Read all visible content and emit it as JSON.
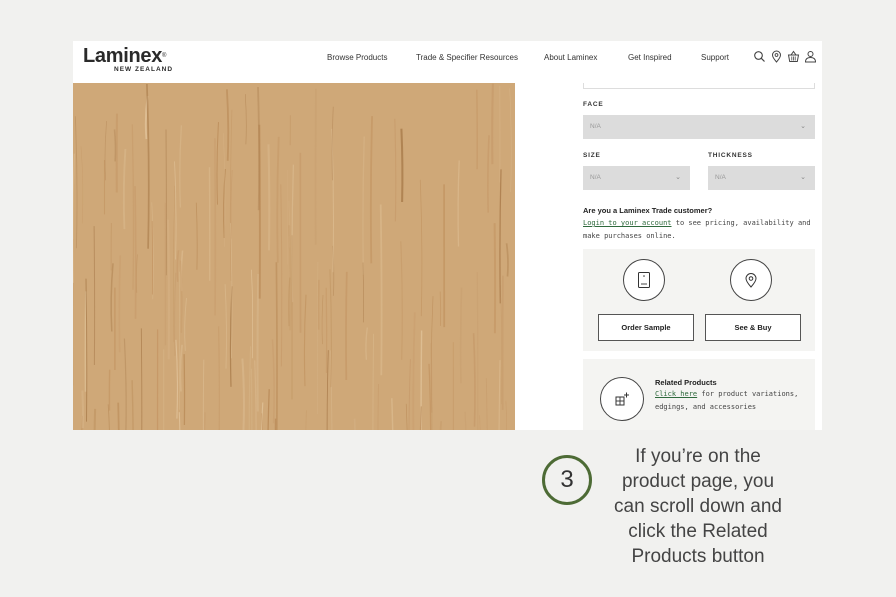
{
  "header": {
    "logo_main": "Laminex",
    "logo_reg": "®",
    "logo_sub": "NEW ZEALAND",
    "nav": [
      "Browse Products",
      "Trade & Specifier Resources",
      "About Laminex",
      "Get Inspired",
      "Support"
    ],
    "icons": [
      "search-icon",
      "location-pin-icon",
      "basket-icon",
      "user-icon"
    ]
  },
  "product_image": {
    "description_icon": "wood-grain-swatch",
    "color": "#cfa878"
  },
  "options": {
    "face_label": "FACE",
    "face_value": "N/A",
    "size_label": "SIZE",
    "size_value": "N/A",
    "thickness_label": "THICKNESS",
    "thickness_value": "N/A"
  },
  "trade": {
    "question": "Are you a Laminex Trade customer?",
    "link": "Login to your account",
    "text": " to see pricing, availability and make purchases online."
  },
  "actions": {
    "order_sample": "Order Sample",
    "see_buy": "See & Buy"
  },
  "related": {
    "title": "Related Products",
    "link": "Click here",
    "text": " for product variations, edgings, and accessories"
  },
  "annotation": {
    "step": "3",
    "lines": [
      "If you’re on the",
      "product page, you",
      "can scroll down and",
      "click the Related",
      "Products button"
    ],
    "accent": "#4d6b35"
  }
}
